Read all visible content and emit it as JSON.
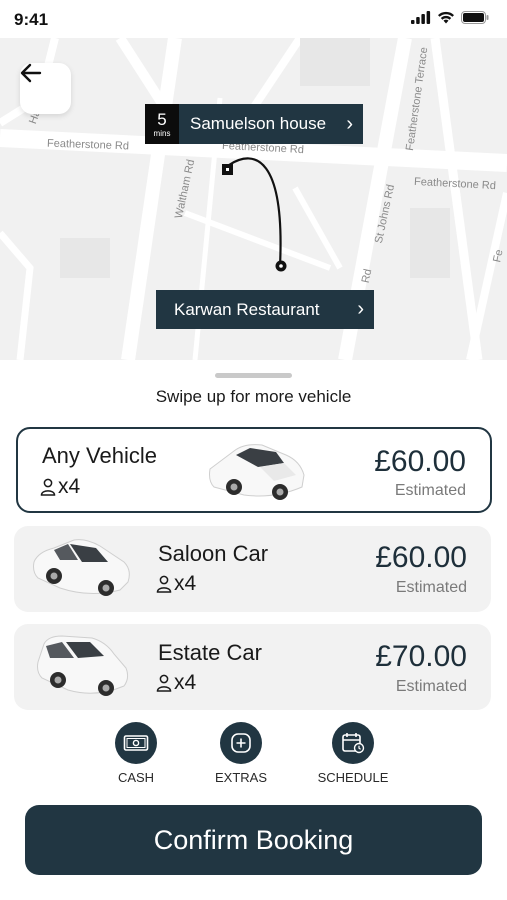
{
  "status_bar": {
    "time": "9:41"
  },
  "map": {
    "streets": {
      "featherstone_rd_left": "Featherstone Rd",
      "featherstone_rd_mid": "Featherstone Rd",
      "featherstone_rd_right": "Featherstone Rd",
      "featherstone_terrace": "Featherstone Terrace",
      "waltham_rd": "Waltham Rd",
      "st_johns_rd": "St Johns Rd",
      "rd_small": "Rd",
      "ha_left": "Ha",
      "fe_right": "Fe"
    },
    "pickup": {
      "mins_value": "5",
      "mins_unit": "mins",
      "label": "Samuelson house",
      "chevron": "›"
    },
    "dropoff": {
      "label": "Karwan Restaurant",
      "chevron": "›"
    }
  },
  "sheet": {
    "swipe_hint": "Swipe up for more vehicle",
    "vehicles": [
      {
        "name": "Any Vehicle",
        "seats": "x4",
        "price": "£60.00",
        "estimate": "Estimated",
        "icon": "car-sedan-icon"
      },
      {
        "name": "Saloon Car",
        "seats": "x4",
        "price": "£60.00",
        "estimate": "Estimated",
        "icon": "car-sedan-icon"
      },
      {
        "name": "Estate Car",
        "seats": "x4",
        "price": "£70.00",
        "estimate": "Estimated",
        "icon": "car-estate-icon"
      }
    ],
    "options": [
      {
        "label": "CASH",
        "icon": "cash-icon"
      },
      {
        "label": "EXTRAS",
        "icon": "plus-icon"
      },
      {
        "label": "SCHEDULE",
        "icon": "calendar-icon"
      }
    ],
    "confirm_label": "Confirm Booking"
  },
  "colors": {
    "primary": "#213642",
    "map_bg": "#f1f1f1",
    "card_bg": "#f2f2f2"
  }
}
